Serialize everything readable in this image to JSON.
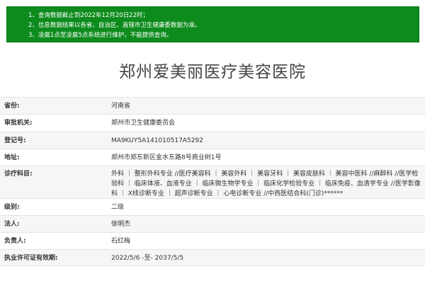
{
  "notice": {
    "lines": [
      "1、查询数据截止到2022年12月20日22时；",
      "2、信息数据结果以各省、自治区、直辖市卫生健康委数据为准。",
      "3、凌晨1点至凌晨5点系统进行维护，不能提供查询。"
    ]
  },
  "title": "郑州爱美丽医疗美容医院",
  "fields": [
    {
      "label": "省份:",
      "value": "河南省"
    },
    {
      "label": "审批机关:",
      "value": "郑州市卫生健康委员会"
    },
    {
      "label": "登记号:",
      "value": "MA9KUY5A141010517A5292"
    },
    {
      "label": "地址:",
      "value": "郑州市郑东新区金水东路8号商业树1号"
    },
    {
      "label": "诊疗科目:",
      "value": "外科 ｜ 整形外科专业 //医疗美容科 ｜ 美容外科 ｜ 美容牙科 ｜ 美容皮肤科 ｜ 美容中医科 //麻醉科 //医学检验科 ｜ 临床体液、血液专业 ｜ 临床微生物学专业 ｜ 临床化学检验专业 ｜ 临床免疫、血清学专业 //医学影像科 ｜ X线诊断专业 ｜ 超声诊断专业 ｜ 心电诊断专业 //中西医结合科(门诊)******"
    },
    {
      "label": "级别:",
      "value": "二级"
    },
    {
      "label": "法人:",
      "value": "徐明杰"
    },
    {
      "label": "负责人:",
      "value": "石红梅"
    },
    {
      "label": "执业许可证有效期:",
      "value": "2022/5/6 -至- 2037/5/5"
    }
  ]
}
